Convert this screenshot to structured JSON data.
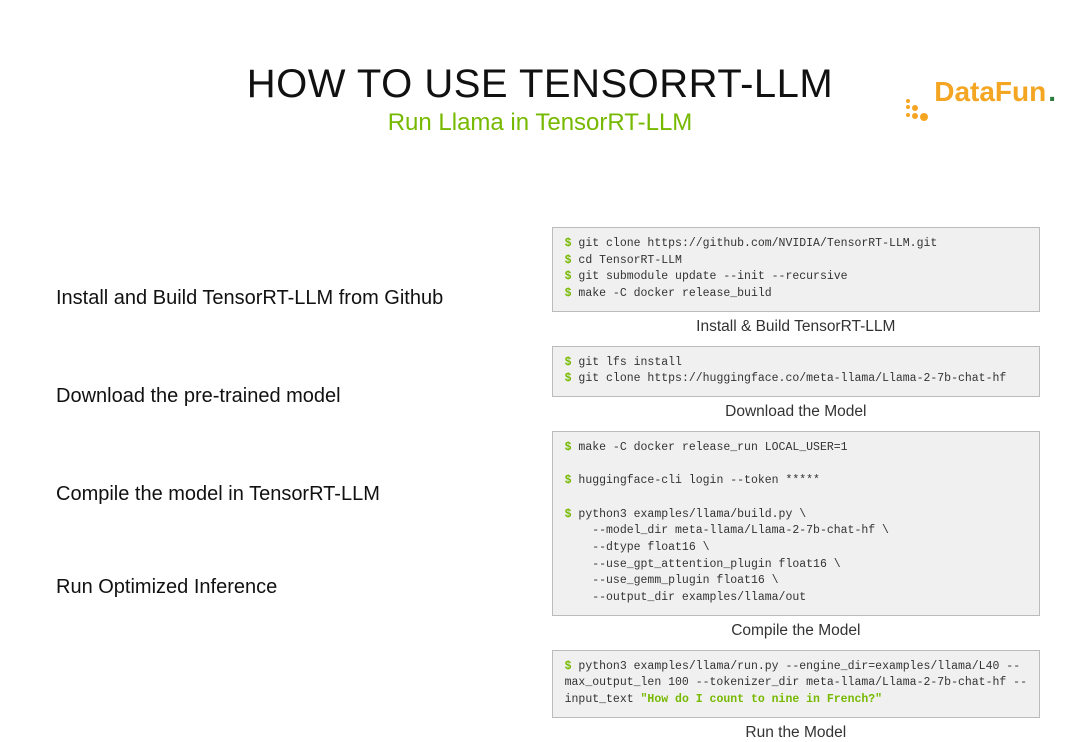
{
  "logo": {
    "text1": "DataFun",
    "dot": "."
  },
  "title": "HOW TO USE TENSORRT-LLM",
  "subtitle": "Run Llama in TensorRT-LLM",
  "steps": {
    "s1": "Install and Build TensorRT-LLM from Github",
    "s2": "Download the pre-trained model",
    "s3": "Compile the model in TensorRT-LLM",
    "s4": "Run Optimized Inference"
  },
  "code": {
    "block1": {
      "l1": "git clone https://github.com/NVIDIA/TensorRT-LLM.git",
      "l2": "cd TensorRT-LLM",
      "l3": "git submodule update --init --recursive",
      "l4": "make -C docker release_build"
    },
    "caption1": "Install & Build TensorRT-LLM",
    "block2": {
      "l1": "git lfs install",
      "l2": "git clone https://huggingface.co/meta-llama/Llama-2-7b-chat-hf"
    },
    "caption2": "Download the Model",
    "block3": {
      "l1": "make -C docker release_run LOCAL_USER=1",
      "l2": "huggingface-cli login --token *****",
      "l3": "python3 examples/llama/build.py \\",
      "l4": "    --model_dir meta-llama/Llama-2-7b-chat-hf \\",
      "l5": "    --dtype float16 \\",
      "l6": "    --use_gpt_attention_plugin float16 \\",
      "l7": "    --use_gemm_plugin float16 \\",
      "l8": "    --output_dir examples/llama/out"
    },
    "caption3": "Compile the Model",
    "block4": {
      "l1a": "python3 examples/llama/run.py --engine_dir=examples/llama/L40 --",
      "l2a": "max_output_len 100 --tokenizer_dir meta-llama/Llama-2-7b-chat-hf --",
      "l3a": "input_text ",
      "l3b": "\"How do I count to nine in French?\""
    },
    "caption4": "Run the Model"
  },
  "prompt": "$ "
}
